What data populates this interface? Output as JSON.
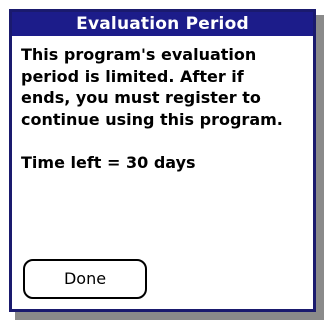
{
  "dialog": {
    "title": "Evaluation Period",
    "message": "This program's evaluation\nperiod is limited.  After if\nends, you must register to\ncontinue using this program.",
    "time_left": "Time left = 30 days",
    "done_label": "Done"
  },
  "colors": {
    "titlebar": "#1c1c8a",
    "border": "#1a1a6e",
    "shadow": "#8a8a8a",
    "background": "#ffffff",
    "text": "#000000"
  }
}
